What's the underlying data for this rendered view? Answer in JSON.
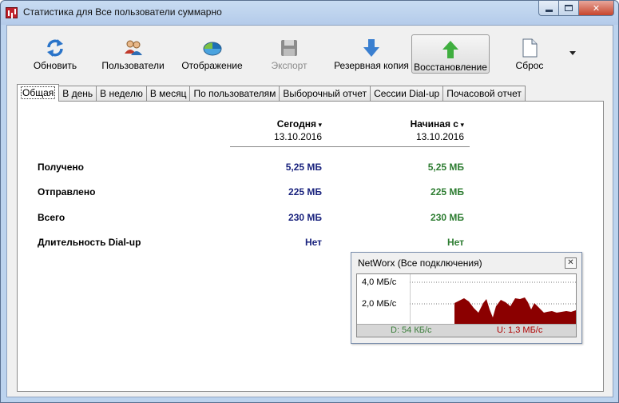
{
  "window": {
    "title": "Статистика для Все пользователи суммарно"
  },
  "toolbar": {
    "buttons": [
      {
        "label": "Обновить",
        "icon": "refresh-icon"
      },
      {
        "label": "Пользователи",
        "icon": "users-icon"
      },
      {
        "label": "Отображение",
        "icon": "display-icon"
      },
      {
        "label": "Экспорт",
        "icon": "save-disk-icon",
        "disabled": true
      },
      {
        "label": "Резервная копия",
        "icon": "arrow-down-icon"
      },
      {
        "label": "Восстановление",
        "icon": "arrow-up-icon"
      },
      {
        "label": "Сброс",
        "icon": "blank-page-icon"
      }
    ]
  },
  "tabs": [
    {
      "label": "Общая",
      "active": true
    },
    {
      "label": "В день"
    },
    {
      "label": "В неделю"
    },
    {
      "label": "В месяц"
    },
    {
      "label": "По пользователям"
    },
    {
      "label": "Выборочный отчет"
    },
    {
      "label": "Сессии Dial-up"
    },
    {
      "label": "Почасовой отчет"
    }
  ],
  "stats": {
    "col_today": {
      "header": "Сегодня",
      "date": "13.10.2016"
    },
    "col_start": {
      "header": "Начиная с",
      "date": "13.10.2016"
    },
    "rows": [
      {
        "label": "Получено",
        "today": "5,25 МБ",
        "start": "5,25 МБ"
      },
      {
        "label": "Отправлено",
        "today": "225 МБ",
        "start": "225 МБ"
      },
      {
        "label": "Всего",
        "today": "230 МБ",
        "start": "230 МБ"
      },
      {
        "label": "Длительность Dial-up",
        "today": "Нет",
        "start": "Нет"
      }
    ]
  },
  "mini_window": {
    "title": "NetWorx (Все подключения)",
    "y_top": "4,0 МБ/с",
    "y_mid": "2,0 МБ/с",
    "download": "D: 54 КБ/с",
    "upload": "U: 1,3 МБ/с"
  },
  "colors": {
    "today_value": "#1a237e",
    "start_value": "#2e7d32",
    "graph_fill": "#8b0000"
  }
}
